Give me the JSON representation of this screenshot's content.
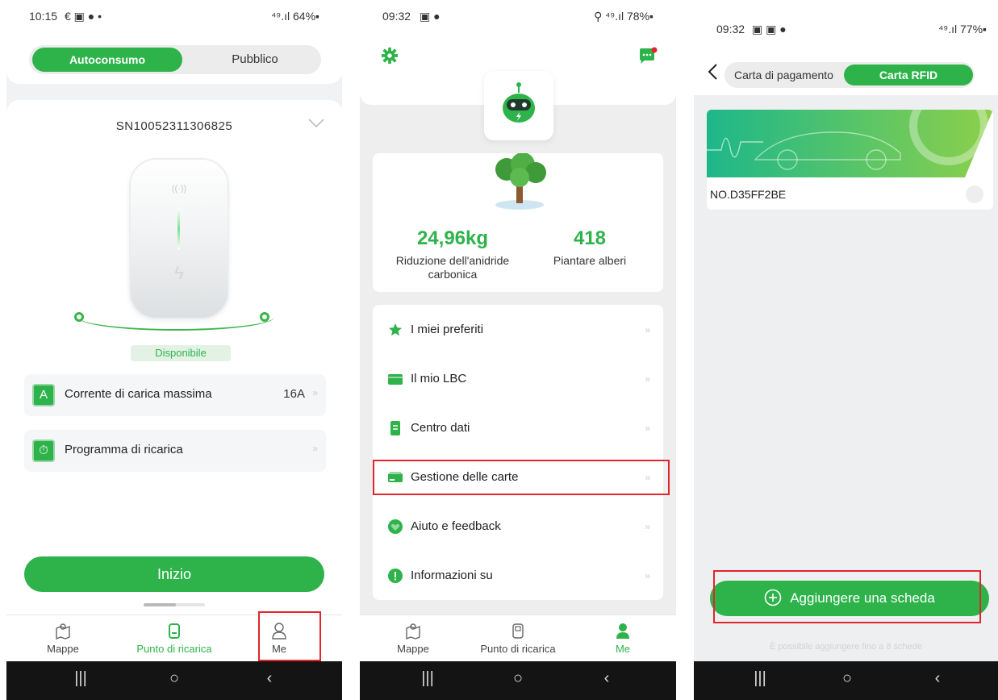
{
  "screen1": {
    "status": {
      "time": "10:15",
      "left_icons": "€ ▣ ● •",
      "right": "⁴⁹.ıl 64%▪"
    },
    "segment": {
      "active": "Autoconsumo",
      "inactive": "Pubblico"
    },
    "serial": "SN10052311306825",
    "charger_status": "Disponibile",
    "rows": [
      {
        "icon_text": "A",
        "label": "Corrente di carica massima",
        "value": "16A"
      },
      {
        "icon_text": "⏱",
        "label": "Programma di ricarica",
        "value": ""
      }
    ],
    "start_button": "Inizio",
    "tabs": [
      {
        "label": "Mappe"
      },
      {
        "label": "Punto di ricarica"
      },
      {
        "label": "Me"
      }
    ]
  },
  "screen2": {
    "status": {
      "time": "09:32",
      "left_icons": "▣ ●",
      "right": "⚲ ⁴⁹.ıl 78%▪"
    },
    "stats": [
      {
        "value": "24,96kg",
        "label": "Riduzione dell'anidride carbonica"
      },
      {
        "value": "418",
        "label": "Piantare alberi"
      }
    ],
    "menu": [
      {
        "label": "I miei preferiti"
      },
      {
        "label": "Il mio LBC"
      },
      {
        "label": "Centro dati"
      },
      {
        "label": "Gestione delle carte"
      },
      {
        "label": "Aiuto e feedback"
      },
      {
        "label": "Informazioni su"
      }
    ],
    "tabs": [
      {
        "label": "Mappe"
      },
      {
        "label": "Punto di ricarica"
      },
      {
        "label": "Me"
      }
    ]
  },
  "screen3": {
    "status": {
      "time": "09:32",
      "left_icons": "▣ ▣ ●",
      "right": "⁴⁹.ıl 77%▪"
    },
    "segment": {
      "inactive": "Carta di pagamento",
      "active": "Carta RFID"
    },
    "card_number": "NO.D35FF2BE",
    "add_button": "Aggiungere una scheda",
    "add_note": "È possibile aggiungere fino a 8 schede"
  },
  "colors": {
    "accent": "#2db34a",
    "highlight": "#e0262c"
  },
  "icons": [
    "gear-icon",
    "chat-icon",
    "robot-icon",
    "tree-icon",
    "star-icon",
    "wallet-icon",
    "document-icon",
    "cards-icon",
    "heart-icon",
    "info-icon",
    "map-icon",
    "charger-icon",
    "user-icon",
    "back-icon",
    "plus-circle-icon"
  ]
}
